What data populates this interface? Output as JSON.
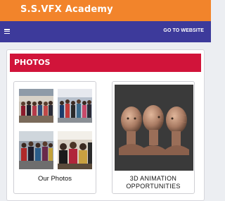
{
  "header": {
    "brand": "S.S.VFX Academy"
  },
  "navbar": {
    "menu_icon": "hamburger-icon",
    "goto_label": "GO TO WEBSITE"
  },
  "section": {
    "title": "PHOTOS"
  },
  "cards": [
    {
      "caption": "Our Photos",
      "image": "group-photos-collage"
    },
    {
      "caption_line1": "3D ANIMATION",
      "caption_line2": "OPPORTUNITIES",
      "image": "3d-head-models"
    }
  ],
  "colors": {
    "top_bar": "#f2842b",
    "nav_bar": "#3d3a9b",
    "header_red": "#d1143a"
  }
}
